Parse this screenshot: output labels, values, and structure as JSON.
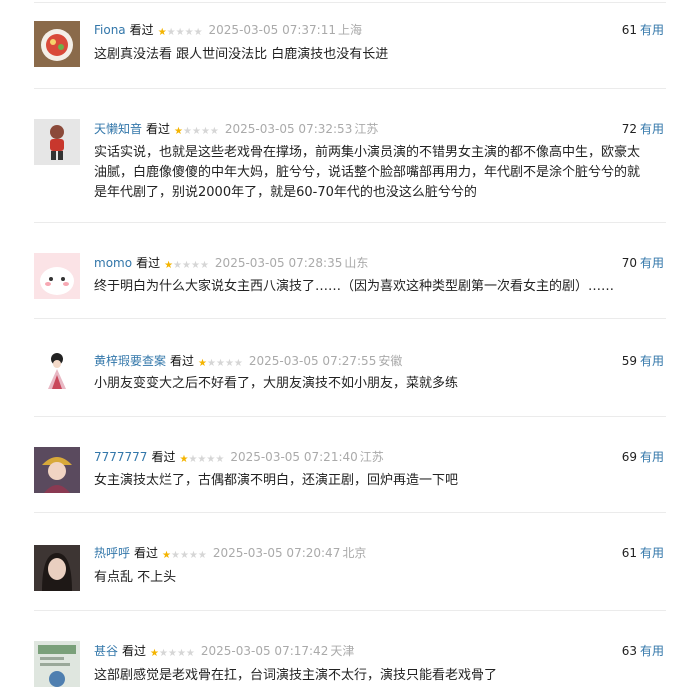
{
  "colors": {
    "username": "#3377aa",
    "useful": "#3377aa",
    "star_on": "#f4b400",
    "star_off": "#d6d6d6",
    "meta_grey": "#aaaaaa"
  },
  "reviews": [
    {
      "username": "Fiona",
      "watch_status": "看过",
      "rating": 1,
      "rating_max": 5,
      "timestamp": "2025-03-05 07:37:11",
      "location": "上海",
      "votes": "61",
      "useful_label": "有用",
      "comment": "这剧真没法看 跟人世间没法比 白鹿演技也没有长进",
      "avatar_icon": "food-bowl-avatar-icon"
    },
    {
      "username": "天懒知音",
      "watch_status": "看过",
      "rating": 1,
      "rating_max": 5,
      "timestamp": "2025-03-05 07:32:53",
      "location": "江苏",
      "votes": "72",
      "useful_label": "有用",
      "comment": "实话实说，也就是这些老戏骨在撑场，前两集小演员演的不错男女主演的都不像高中生，欧豪太油腻，白鹿像傻傻的中年大妈，脏兮兮，说话整个脸部嘴部再用力，年代剧不是涂个脏兮兮的就是年代剧了，别说2000年了，就是60-70年代的也没这么脏兮兮的",
      "avatar_icon": "figurine-avatar-icon"
    },
    {
      "username": "momo",
      "watch_status": "看过",
      "rating": 1,
      "rating_max": 5,
      "timestamp": "2025-03-05 07:28:35",
      "location": "山东",
      "votes": "70",
      "useful_label": "有用",
      "comment": "终于明白为什么大家说女主西八演技了……（因为喜欢这种类型剧第一次看女主的剧）……",
      "avatar_icon": "pink-cartoon-avatar-icon"
    },
    {
      "username": "黄梓瑕要查案",
      "watch_status": "看过",
      "rating": 1,
      "rating_max": 5,
      "timestamp": "2025-03-05 07:27:55",
      "location": "安徽",
      "votes": "59",
      "useful_label": "有用",
      "comment": "小朋友变变大之后不好看了，大朋友演技不如小朋友，菜就多练",
      "avatar_icon": "ancient-costume-avatar-icon"
    },
    {
      "username": "7777777",
      "watch_status": "看过",
      "rating": 1,
      "rating_max": 5,
      "timestamp": "2025-03-05 07:21:40",
      "location": "江苏",
      "votes": "69",
      "useful_label": "有用",
      "comment": "女主演技太烂了，古偶都演不明白，还演正剧，回炉再造一下吧",
      "avatar_icon": "headdress-avatar-icon"
    },
    {
      "username": "热呼呼",
      "watch_status": "看过",
      "rating": 1,
      "rating_max": 5,
      "timestamp": "2025-03-05 07:20:47",
      "location": "北京",
      "votes": "61",
      "useful_label": "有用",
      "comment": "有点乱 不上头",
      "avatar_icon": "portrait-avatar-icon"
    },
    {
      "username": "甚谷",
      "watch_status": "看过",
      "rating": 1,
      "rating_max": 5,
      "timestamp": "2025-03-05 07:17:42",
      "location": "天津",
      "votes": "63",
      "useful_label": "有用",
      "comment": "这部剧感觉是老戏骨在扛，台词演技主演不太行，演技只能看老戏骨了",
      "avatar_icon": "document-avatar-icon"
    }
  ]
}
